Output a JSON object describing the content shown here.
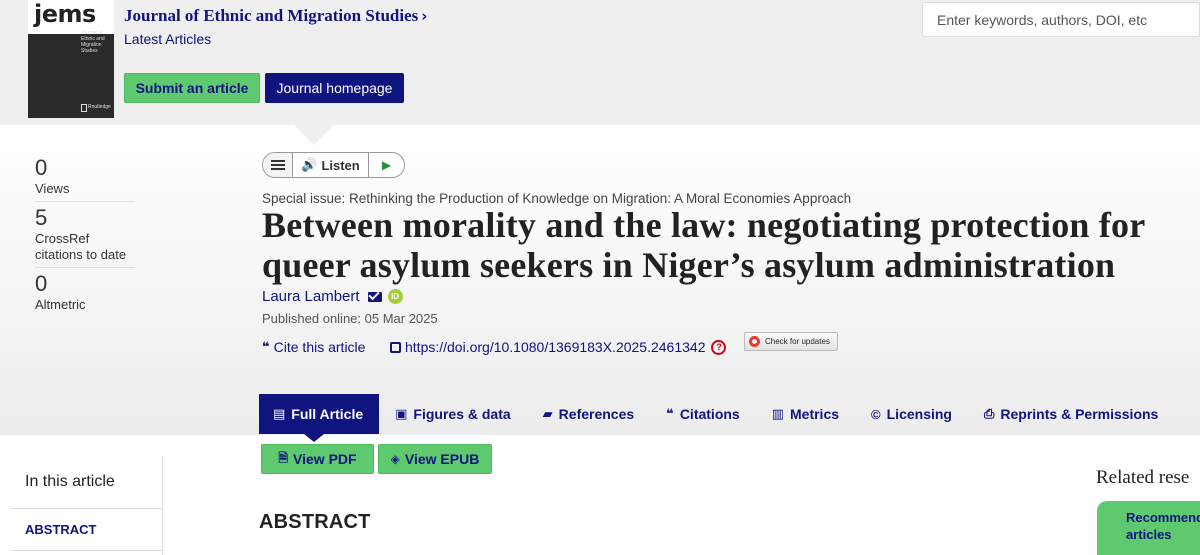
{
  "journal": {
    "cover_logo": "jems",
    "cover_subtitle": "Journal of Ethnic and Migration Studies",
    "cover_publisher": "Routledge",
    "title": "Journal of Ethnic and Migration Studies",
    "chevron": "›",
    "latest": "Latest Articles"
  },
  "buttons": {
    "submit": "Submit an article",
    "homepage": "Journal homepage"
  },
  "search": {
    "placeholder": "Enter keywords, authors, DOI, etc"
  },
  "metrics": [
    {
      "value": "0",
      "label": "Views"
    },
    {
      "value": "5",
      "label": "CrossRef citations to date"
    },
    {
      "value": "0",
      "label": "Altmetric"
    }
  ],
  "listen": {
    "label": "Listen"
  },
  "article": {
    "special_issue": "Special issue: Rethinking the Production of Knowledge on Migration: A Moral Economies Approach",
    "title": "Between morality and the law: negotiating protection for queer asylum seekers in Niger’s asylum administration",
    "author": "Laura Lambert",
    "published": "Published online: 05 Mar 2025",
    "cite_label": "Cite this article",
    "doi": "https://doi.org/10.1080/1369183X.2025.2461342",
    "check_updates": "Check for updates"
  },
  "tabs": [
    {
      "label": "Full Article",
      "icon": "document-icon",
      "glyph": "▤",
      "active": true
    },
    {
      "label": "Figures & data",
      "icon": "image-icon",
      "glyph": "▣",
      "active": false
    },
    {
      "label": "References",
      "icon": "book-icon",
      "glyph": "▰",
      "active": false
    },
    {
      "label": "Citations",
      "icon": "quote-icon",
      "glyph": "❝",
      "active": false
    },
    {
      "label": "Metrics",
      "icon": "bar-chart-icon",
      "glyph": "▥",
      "active": false
    },
    {
      "label": "Licensing",
      "icon": "copyright-icon",
      "glyph": "©",
      "active": false
    },
    {
      "label": "Reprints & Permissions",
      "icon": "print-icon",
      "glyph": "⎙",
      "active": false
    }
  ],
  "downloads": {
    "pdf": "View PDF",
    "epub": "View EPUB"
  },
  "sidebar": {
    "heading": "In this article",
    "abstract_link": "ABSTRACT"
  },
  "section": {
    "abstract_heading": "ABSTRACT"
  },
  "related": {
    "heading": "Related rese",
    "recommended": "Recommended articles"
  },
  "colors": {
    "brand_navy": "#10147e",
    "accent_green": "#5fc970",
    "header_bg": "#efefef"
  }
}
